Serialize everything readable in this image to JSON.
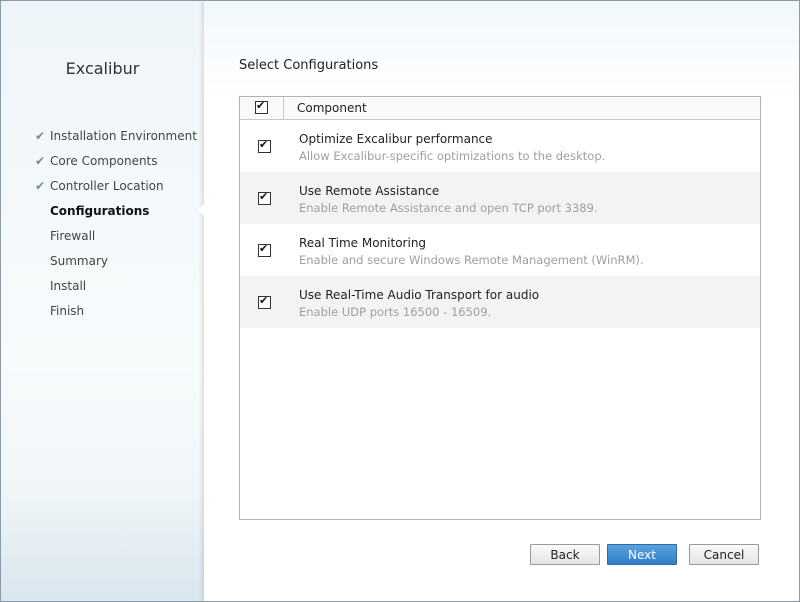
{
  "app": {
    "title": "Excalibur"
  },
  "steps": [
    {
      "label": "Installation Environment",
      "state": "done"
    },
    {
      "label": "Core Components",
      "state": "done"
    },
    {
      "label": "Controller Location",
      "state": "done"
    },
    {
      "label": "Configurations",
      "state": "current"
    },
    {
      "label": "Firewall",
      "state": "pending"
    },
    {
      "label": "Summary",
      "state": "pending"
    },
    {
      "label": "Install",
      "state": "pending"
    },
    {
      "label": "Finish",
      "state": "pending"
    }
  ],
  "check_glyph": "✔",
  "section": {
    "title": "Select Configurations"
  },
  "table": {
    "header": {
      "label": "Component",
      "checked": true
    },
    "rows": [
      {
        "name": "Optimize Excalibur performance",
        "description": "Allow Excalibur-specific optimizations to the desktop.",
        "checked": true
      },
      {
        "name": "Use Remote Assistance",
        "description": "Enable Remote Assistance and open TCP port 3389.",
        "checked": true
      },
      {
        "name": "Real Time Monitoring",
        "description": "Enable and secure Windows Remote Management (WinRM).",
        "checked": true
      },
      {
        "name": "Use Real-Time Audio Transport for audio",
        "description": "Enable UDP ports 16500 - 16509.",
        "checked": true
      }
    ]
  },
  "buttons": {
    "back": "Back",
    "next": "Next",
    "cancel": "Cancel"
  },
  "colors": {
    "primary": "#2f7fc8",
    "done_check": "#7a8a93",
    "muted_text": "#9aa0a4"
  }
}
